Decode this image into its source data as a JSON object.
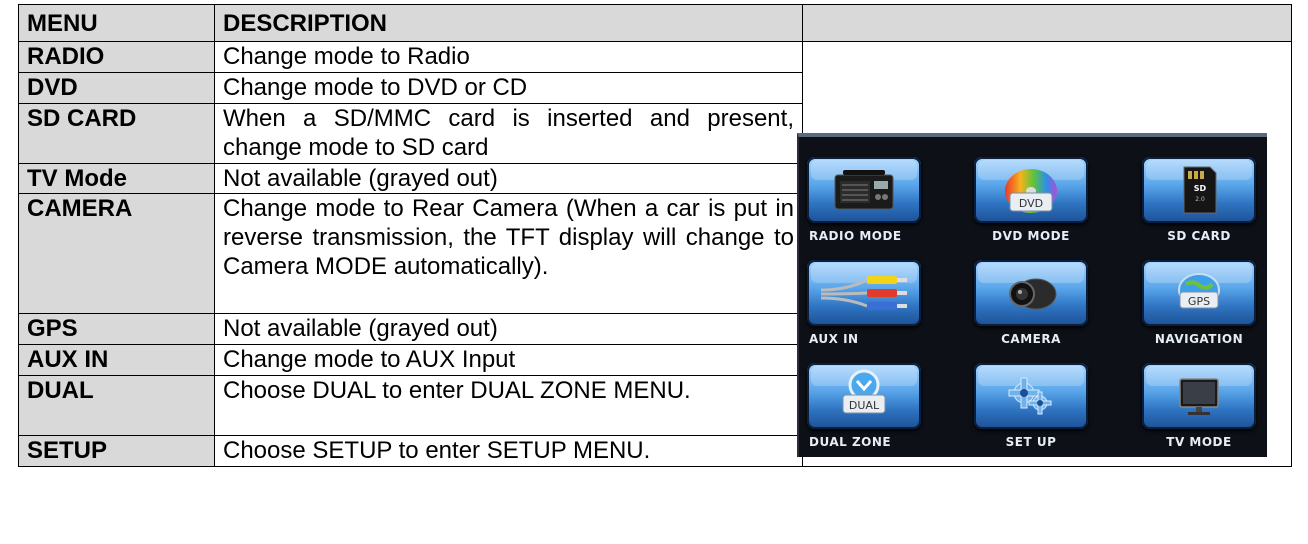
{
  "table": {
    "header": {
      "menu": "MENU",
      "description": "DESCRIPTION"
    },
    "rows": [
      {
        "menu": "RADIO",
        "description": "Change mode to Radio"
      },
      {
        "menu": "DVD",
        "description": "Change mode to DVD or CD"
      },
      {
        "menu": "SD CARD",
        "description": "When a SD/MMC card is inserted and present, change mode to SD card"
      },
      {
        "menu": "TV Mode",
        "description": "Not available (grayed out)"
      },
      {
        "menu": "CAMERA",
        "description": "Change mode to Rear Camera (When a car is put in reverse transmission, the TFT display will change to Camera MODE automatically)."
      },
      {
        "menu": "GPS",
        "description": "Not available (grayed out)"
      },
      {
        "menu": "AUX IN",
        "description": "Change mode to AUX Input"
      },
      {
        "menu": "DUAL",
        "description": "Choose DUAL to enter DUAL ZONE MENU."
      },
      {
        "menu": "SETUP",
        "description": "Choose SETUP to enter SETUP MENU."
      }
    ]
  },
  "screen": {
    "tiles": [
      {
        "label": "RADIO MODE",
        "icon": "radio-icon"
      },
      {
        "label": "DVD MODE",
        "icon": "dvd-icon",
        "icon_text": "DVD"
      },
      {
        "label": "SD CARD",
        "icon": "sd-card-icon"
      },
      {
        "label": "AUX IN",
        "icon": "aux-cables-icon"
      },
      {
        "label": "CAMERA",
        "icon": "camera-icon"
      },
      {
        "label": "NAVIGATION",
        "icon": "gps-icon",
        "icon_text": "GPS"
      },
      {
        "label": "DUAL ZONE",
        "icon": "dual-icon",
        "icon_text": "DUAL"
      },
      {
        "label": "SET UP",
        "icon": "gear-icon"
      },
      {
        "label": "TV MODE",
        "icon": "tv-icon"
      }
    ]
  },
  "colors": {
    "header_bg": "#d9d9d9",
    "screen_bg": "#0d1017",
    "button_blue": "#2f75c3"
  }
}
